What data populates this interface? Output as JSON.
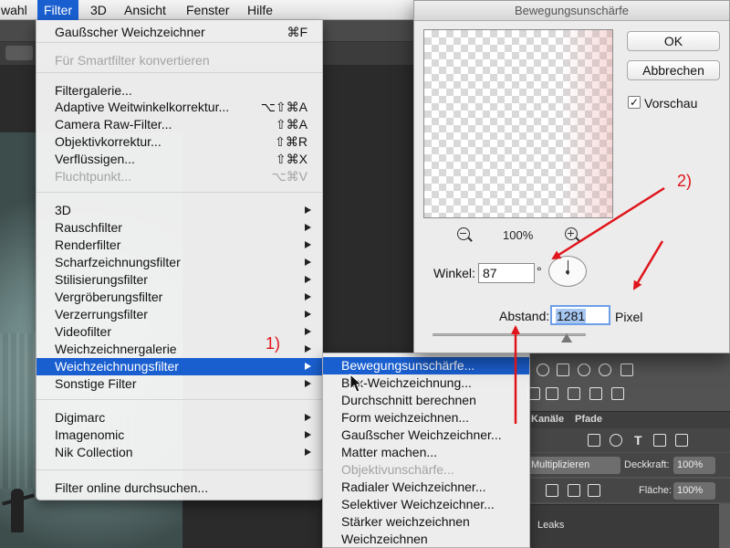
{
  "menubar": {
    "items": [
      {
        "label": "wahl"
      },
      {
        "label": "Filter"
      },
      {
        "label": "3D"
      },
      {
        "label": "Ansicht"
      },
      {
        "label": "Fenster"
      },
      {
        "label": "Hilfe"
      }
    ]
  },
  "filter_menu": {
    "items": [
      {
        "label": "Gaußscher Weichzeichner",
        "shortcut": "⌘F",
        "state": "normal"
      },
      {
        "label": "Für Smartfilter konvertieren",
        "shortcut": "",
        "state": "disabled"
      },
      {
        "label": "Filtergalerie...",
        "shortcut": "",
        "state": "normal"
      },
      {
        "label": "Adaptive Weitwinkelkorrektur...",
        "shortcut": "⌥⇧⌘A",
        "state": "normal"
      },
      {
        "label": "Camera Raw-Filter...",
        "shortcut": "⇧⌘A",
        "state": "normal"
      },
      {
        "label": "Objektivkorrektur...",
        "shortcut": "⇧⌘R",
        "state": "normal"
      },
      {
        "label": "Verflüssigen...",
        "shortcut": "⇧⌘X",
        "state": "normal"
      },
      {
        "label": "Fluchtpunkt...",
        "shortcut": "⌥⌘V",
        "state": "disabled"
      },
      {
        "label": "3D",
        "state": "submenu"
      },
      {
        "label": "Rauschfilter",
        "state": "submenu"
      },
      {
        "label": "Renderfilter",
        "state": "submenu"
      },
      {
        "label": "Scharfzeichnungsfilter",
        "state": "submenu"
      },
      {
        "label": "Stilisierungsfilter",
        "state": "submenu"
      },
      {
        "label": "Vergröberungsfilter",
        "state": "submenu"
      },
      {
        "label": "Verzerrungsfilter",
        "state": "submenu"
      },
      {
        "label": "Videofilter",
        "state": "submenu"
      },
      {
        "label": "Weichzeichnergalerie",
        "state": "submenu"
      },
      {
        "label": "Weichzeichnungsfilter",
        "state": "active"
      },
      {
        "label": "Sonstige Filter",
        "state": "submenu"
      },
      {
        "label": "Digimarc",
        "state": "submenu"
      },
      {
        "label": "Imagenomic",
        "state": "submenu"
      },
      {
        "label": "Nik Collection",
        "state": "submenu"
      },
      {
        "label": "Filter online durchsuchen...",
        "shortcut": "",
        "state": "normal"
      }
    ]
  },
  "submenu": {
    "items": [
      {
        "label": "Bewegungsunschärfe...",
        "state": "active"
      },
      {
        "label": "Box-Weichzeichnung...",
        "state": "normal"
      },
      {
        "label": "Durchschnitt berechnen",
        "state": "normal"
      },
      {
        "label": "Form weichzeichnen...",
        "state": "normal"
      },
      {
        "label": "Gaußscher Weichzeichner...",
        "state": "normal"
      },
      {
        "label": "Matter machen...",
        "state": "normal"
      },
      {
        "label": "Objektivunschärfe...",
        "state": "disabled"
      },
      {
        "label": "Radialer Weichzeichner...",
        "state": "normal"
      },
      {
        "label": "Selektiver Weichzeichner...",
        "state": "normal"
      },
      {
        "label": "Stärker weichzeichnen",
        "state": "normal"
      },
      {
        "label": "Weichzeichnen",
        "state": "normal"
      }
    ]
  },
  "dialog": {
    "title": "Bewegungsunschärfe",
    "ok_label": "OK",
    "cancel_label": "Abbrechen",
    "preview_label": "Vorschau",
    "preview_checked": true,
    "preview_check_mark": "✓",
    "zoom_level": "100%",
    "angle_label": "Winkel:",
    "angle_value": "87",
    "angle_unit": "°",
    "distance_label": "Abstand:",
    "distance_value": "1281",
    "distance_unit": "Pixel"
  },
  "annotations": {
    "step1": "1)",
    "step2": "2)",
    "color": "#e0141a"
  },
  "layers_panel": {
    "tabs": [
      "Kanäle",
      "Pfade"
    ],
    "blend_mode": "Multiplizieren",
    "opacity_label": "Deckkraft:",
    "opacity_value": "100%",
    "fill_label": "Fläche:",
    "fill_value": "100%",
    "layer_name": "Leaks"
  },
  "colors": {
    "menu_highlight": "#1a5fd0",
    "panel_bg": "#535353"
  }
}
